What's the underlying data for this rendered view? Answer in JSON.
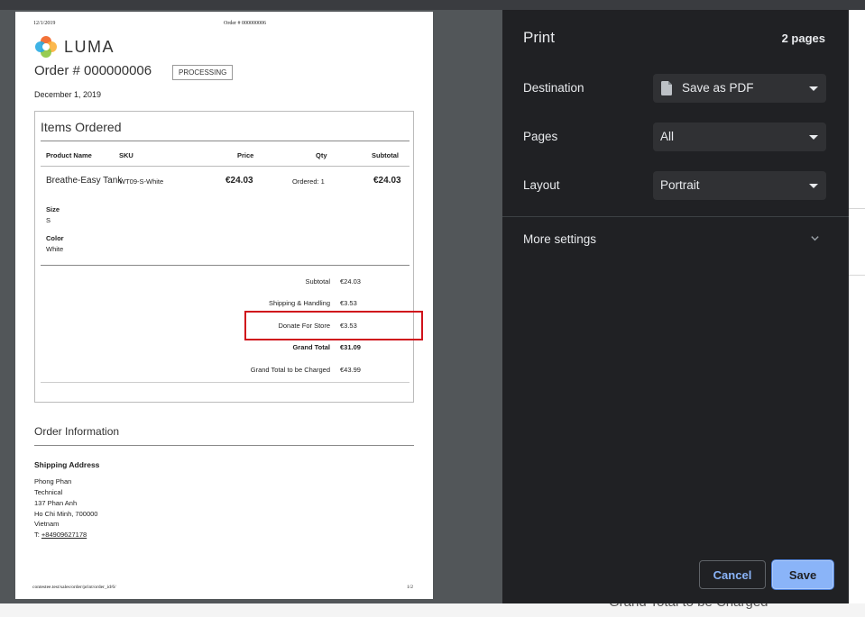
{
  "background": {
    "text": "Grand Total to be Charged"
  },
  "document": {
    "header_date": "12/1/2019",
    "header_order": "Order # 000000006",
    "logo_text": "LUMA",
    "order_title": "Order # 000000006",
    "status": "PROCESSING",
    "order_date": "December 1, 2019",
    "items_title": "Items Ordered",
    "columns": {
      "product": "Product Name",
      "sku": "SKU",
      "price": "Price",
      "qty": "Qty",
      "subtotal": "Subtotal"
    },
    "item": {
      "name": "Breathe-Easy Tank",
      "sku": "WT09-S-White",
      "price": "€24.03",
      "qty": "Ordered: 1",
      "subtotal": "€24.03",
      "size_label": "Size",
      "size_value": "S",
      "color_label": "Color",
      "color_value": "White"
    },
    "totals": [
      {
        "label": "Subtotal",
        "value": "€24.03",
        "bold": false
      },
      {
        "label": "Shipping & Handling",
        "value": "€3.53",
        "bold": false
      },
      {
        "label": "Donate For Store",
        "value": "€3.53",
        "bold": false
      },
      {
        "label": "Grand Total",
        "value": "€31.09",
        "bold": true
      },
      {
        "label": "Grand Total to be Charged",
        "value": "€43.99",
        "bold": false
      }
    ],
    "order_info_title": "Order Information",
    "shipping_title": "Shipping Address",
    "address_lines": [
      "Phong Phan",
      "Technical",
      "137 Phan Anh",
      "Ho Chi Minh, 700000",
      "Vietnam"
    ],
    "phone_prefix": "T: ",
    "phone": "+84909627178",
    "footer_url": "contestee.test/sales/order/print/order_id/6/",
    "footer_page": "1/2"
  },
  "print": {
    "title": "Print",
    "page_count": "2 pages",
    "destination_label": "Destination",
    "destination_value": "Save as PDF",
    "pages_label": "Pages",
    "pages_value": "All",
    "layout_label": "Layout",
    "layout_value": "Portrait",
    "more_settings": "More settings",
    "cancel": "Cancel",
    "save": "Save"
  },
  "colors": {
    "highlight": "#d0121b",
    "panel_bg": "#202124",
    "accent": "#8ab4f8",
    "preview_bg": "#525659"
  }
}
